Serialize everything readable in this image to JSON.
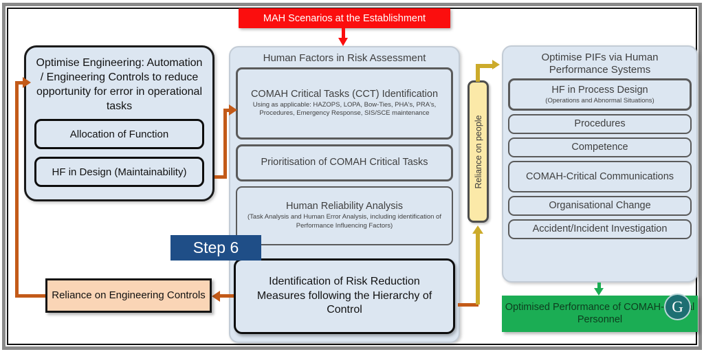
{
  "diagram": {
    "top_banner": "MAH Scenarios at the Establishment",
    "step_label": "Step 6",
    "logo_letter": "G"
  },
  "left_box": {
    "title": "Optimise Engineering: Automation / Engineering Controls to reduce opportunity for error in operational tasks",
    "items": [
      {
        "label": "Allocation of Function"
      },
      {
        "label": "HF in Design (Maintainability)"
      }
    ]
  },
  "centre_panel": {
    "title": "Human Factors in Risk Assessment",
    "items": [
      {
        "title": "COMAH Critical Tasks (CCT) Identification",
        "detail": "Using as applicable: HAZOPS, LOPA, Bow-Ties, PHA's, PRA's, Procedures, Emergency Response, SIS/SCE maintenance"
      },
      {
        "title": "Prioritisation of COMAH Critical Tasks",
        "detail": ""
      },
      {
        "title": "Human Reliability Analysis",
        "detail": "(Task Analysis and Human Error Analysis, including identification of Performance Influencing Factors)"
      }
    ],
    "outcome_box": "Identification of Risk Reduction Measures following the Hierarchy of Control"
  },
  "right_panel": {
    "title": "Optimise PIFs via Human Performance Systems",
    "items": [
      {
        "title": "HF in Process Design",
        "detail": "(Operations and Abnormal Situations)"
      },
      {
        "title": "Procedures",
        "detail": ""
      },
      {
        "title": "Competence",
        "detail": ""
      },
      {
        "title": "COMAH-Critical Communications",
        "detail": ""
      },
      {
        "title": "Organisational Change",
        "detail": ""
      },
      {
        "title": "Accident/Incident Investigation",
        "detail": ""
      }
    ]
  },
  "reliance_people_bar": "Reliance on people",
  "orange_box": "Reliance on Engineering Controls",
  "green_box": "Optimised Performance of COMAH-Critical Personnel",
  "colors": {
    "banner_red": "#fb0e0e",
    "panel_blue": "#dce6f1",
    "orange_box": "#fad5b6",
    "connector_orange": "#c35a18",
    "connector_yellow": "#ccab2b",
    "yellow_bar": "#fbe9a8",
    "green_box": "#1bad54",
    "step_blue": "#1f4e87",
    "logo_teal": "#1d6f72"
  }
}
